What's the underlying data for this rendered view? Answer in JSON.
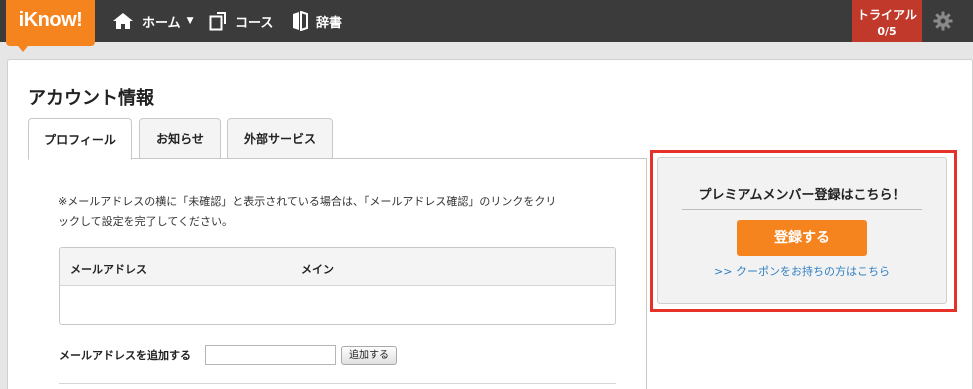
{
  "header": {
    "logo": "iKnow!",
    "nav": [
      {
        "label": "ホーム",
        "icon": "home-icon"
      },
      {
        "label": "コース",
        "icon": "course-icon"
      },
      {
        "label": "辞書",
        "icon": "dictionary-icon"
      }
    ],
    "trial_label": "トライアル",
    "trial_count": "0/5",
    "settings_icon": "gear-icon"
  },
  "page_title": "アカウント情報",
  "tabs": [
    "プロフィール",
    "お知らせ",
    "外部サービス"
  ],
  "active_tab": "プロフィール",
  "note_line1": "※メールアドレスの横に「未確認」と表示されている場合は、「メールアドレス確認」のリンクをクリ",
  "note_line2": "ックして設定を完了してください。",
  "email_table": {
    "columns": [
      "メールアドレス",
      "メイン"
    ],
    "rows": []
  },
  "add_email": {
    "label": "メールアドレスを追加する",
    "value": "",
    "button": "追加する"
  },
  "premium": {
    "title": "プレミアムメンバー登録はこちら！",
    "button": "登録する",
    "coupon_link": ">> クーポンをお持ちの方はこちら"
  },
  "colors": {
    "topbar": "#3b3b3b",
    "accent": "#f5841f",
    "trial": "#c0392b",
    "highlight": "#e53228",
    "link": "#2e7fc2"
  }
}
